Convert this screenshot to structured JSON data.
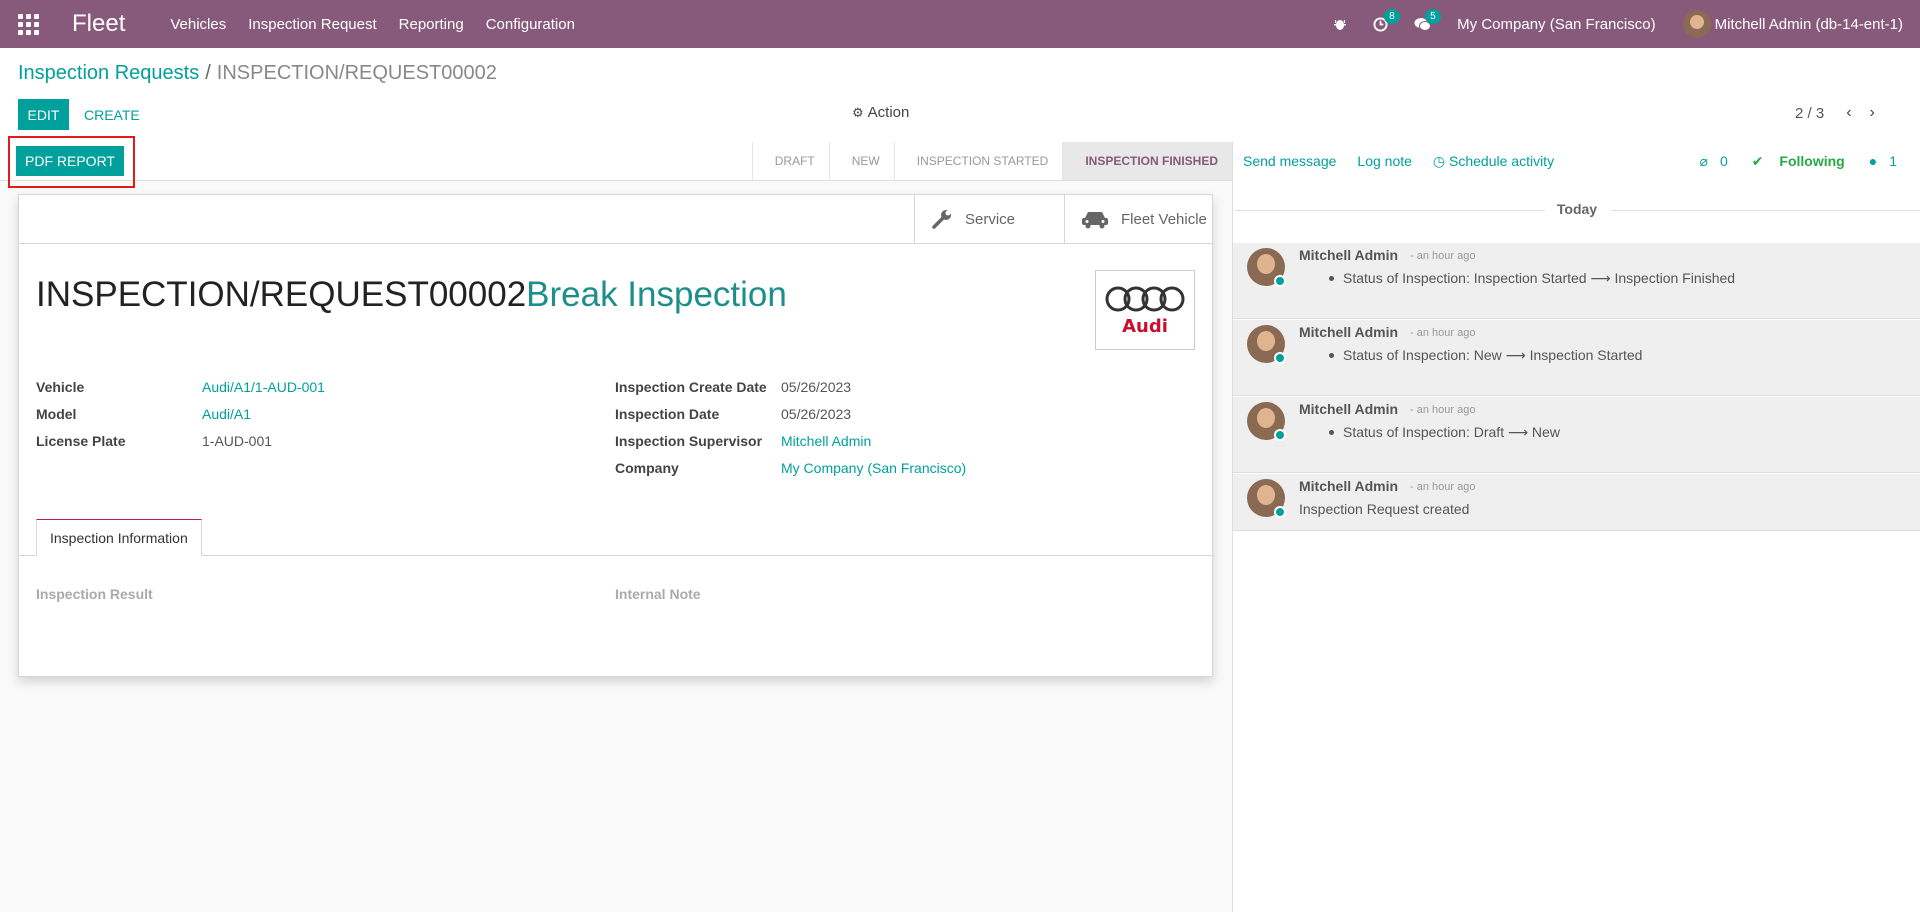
{
  "navbar": {
    "brand": "Fleet",
    "menu": [
      "Vehicles",
      "Inspection Request",
      "Reporting",
      "Configuration"
    ],
    "activity_count": "8",
    "message_count": "5",
    "company": "My Company (San Francisco)",
    "user": "Mitchell Admin (db-14-ent-1)"
  },
  "breadcrumb": {
    "parent": "Inspection Requests",
    "separator": "/",
    "current": "INSPECTION/REQUEST00002"
  },
  "toolbar": {
    "edit_label": "EDIT",
    "create_label": "CREATE",
    "action_label": "Action",
    "pager": "2 / 3"
  },
  "statusbar": {
    "pdf_label": "PDF REPORT",
    "stages": [
      "DRAFT",
      "NEW",
      "INSPECTION STARTED",
      "INSPECTION FINISHED"
    ],
    "active_stage": "INSPECTION FINISHED"
  },
  "smart_buttons": {
    "service": "Service",
    "fleet_vehicle": "Fleet Vehicle"
  },
  "record": {
    "reference": "INSPECTION/REQUEST00002",
    "name": "Break Inspection",
    "logo_text": "Audi",
    "left_fields": [
      {
        "label": "Vehicle",
        "value": "Audi/A1/1-AUD-001",
        "link": true
      },
      {
        "label": "Model",
        "value": "Audi/A1",
        "link": true
      },
      {
        "label": "License Plate",
        "value": "1-AUD-001",
        "link": false
      }
    ],
    "right_fields": [
      {
        "label": "Inspection Create Date",
        "value": "05/26/2023",
        "link": false
      },
      {
        "label": "Inspection Date",
        "value": "05/26/2023",
        "link": false
      },
      {
        "label": "Inspection Supervisor",
        "value": "Mitchell Admin",
        "link": true
      },
      {
        "label": "Company",
        "value": "My Company (San Francisco)",
        "link": true
      }
    ],
    "tab_label": "Inspection Information",
    "result_label": "Inspection Result",
    "note_label": "Internal Note"
  },
  "chatter": {
    "send_message": "Send message",
    "log_note": "Log note",
    "schedule_activity": "Schedule activity",
    "attachments": "0",
    "following": "Following",
    "followers": "1",
    "date_separator": "Today",
    "messages": [
      {
        "author": "Mitchell Admin",
        "date": "- an hour ago",
        "text": "Status of Inspection: Inspection Started ⟶ Inspection Finished"
      },
      {
        "author": "Mitchell Admin",
        "date": "- an hour ago",
        "text": "Status of Inspection: New ⟶ Inspection Started"
      },
      {
        "author": "Mitchell Admin",
        "date": "- an hour ago",
        "text": "Status of Inspection: Draft ⟶ New"
      },
      {
        "author": "Mitchell Admin",
        "date": "- an hour ago",
        "text": "Inspection Request created"
      }
    ]
  },
  "colors": {
    "navbar": "#875a7b",
    "primary": "#00a09d",
    "highlight_border": "#e21b1b",
    "following": "#28a745"
  }
}
